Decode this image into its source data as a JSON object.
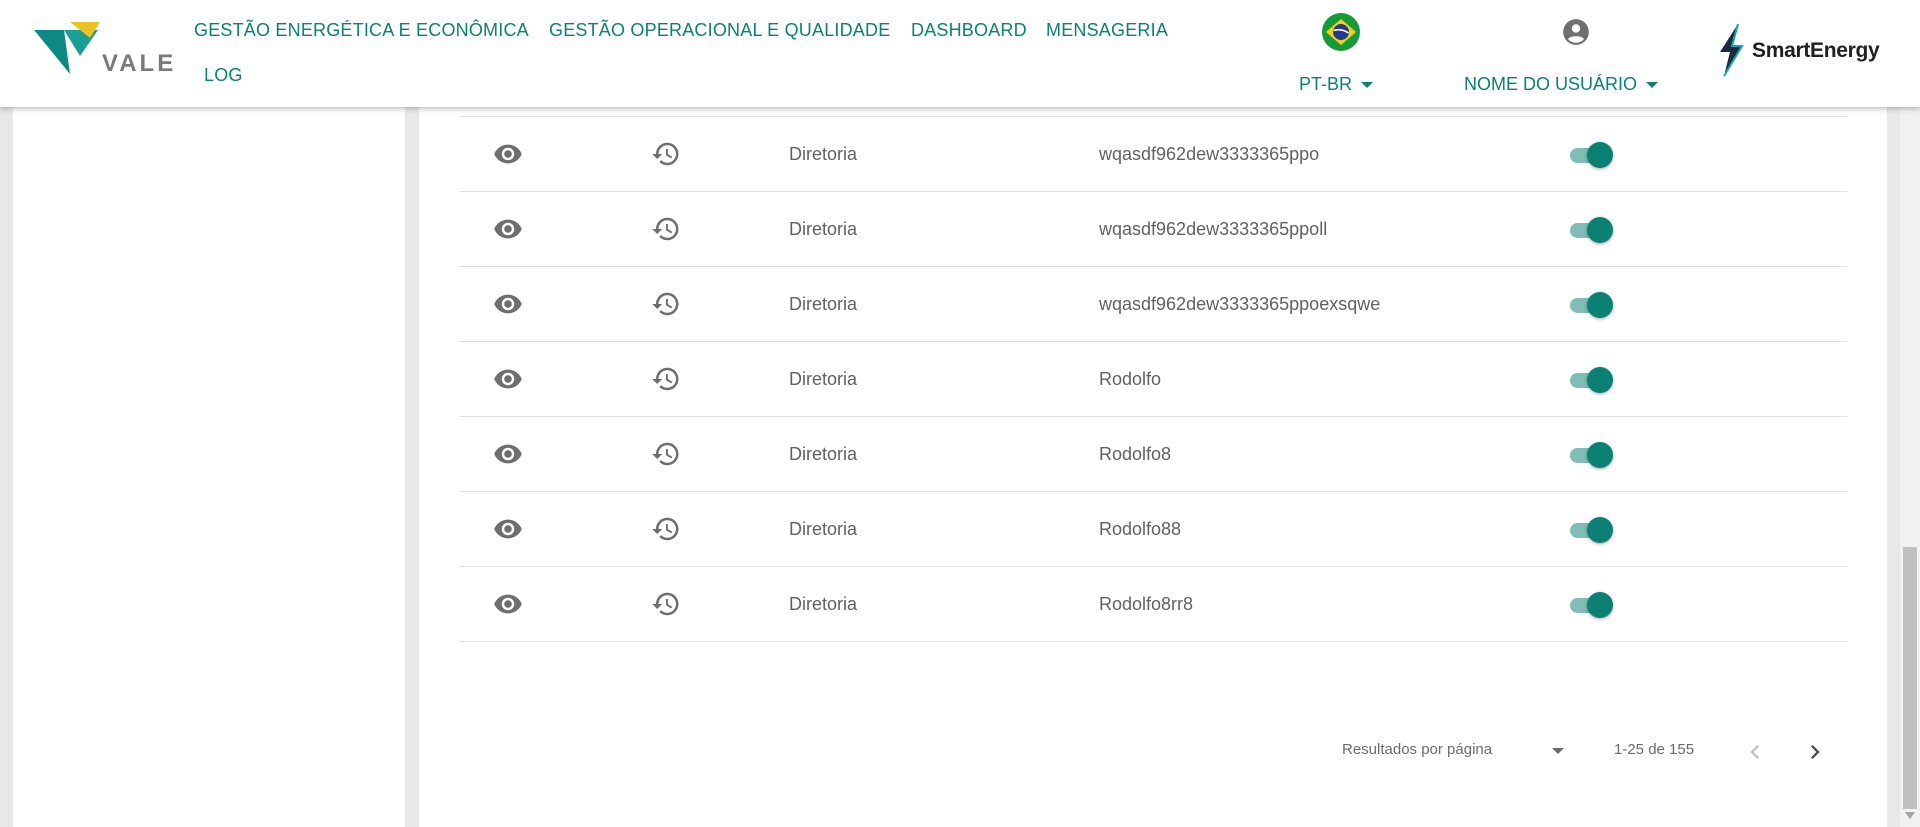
{
  "header": {
    "nav": [
      "GESTÃO ENERGÉTICA E ECONÔMICA",
      "GESTÃO OPERACIONAL E QUALIDADE",
      "DASHBOARD",
      "MENSAGERIA",
      "LOG"
    ],
    "vale_logo_text": "VALE",
    "language": "PT-BR",
    "user_name": "NOME DO USUÁRIO",
    "brand_logo_text": "SmartEnergy"
  },
  "colors": {
    "accent": "#0b8174",
    "toggle_track": "#7fbdb6",
    "icon_gray": "#707070"
  },
  "table": {
    "rows": [
      {
        "area": "Diretoria",
        "name": "wqasdf962dew3333365ppo",
        "active": true
      },
      {
        "area": "Diretoria",
        "name": "wqasdf962dew3333365ppoll",
        "active": true
      },
      {
        "area": "Diretoria",
        "name": "wqasdf962dew3333365ppoexsqwe",
        "active": true
      },
      {
        "area": "Diretoria",
        "name": "Rodolfo",
        "active": true
      },
      {
        "area": "Diretoria",
        "name": "Rodolfo8",
        "active": true
      },
      {
        "area": "Diretoria",
        "name": "Rodolfo88",
        "active": true
      },
      {
        "area": "Diretoria",
        "name": "Rodolfo8rr8",
        "active": true
      }
    ],
    "row_icons": [
      "eye-icon",
      "history-icon"
    ]
  },
  "pagination": {
    "per_page_label": "Resultados por página",
    "range": "1-25 de 155"
  }
}
